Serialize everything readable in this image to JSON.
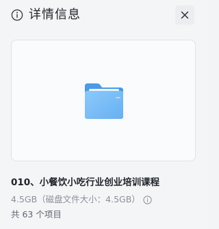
{
  "header": {
    "title": "详情信息",
    "icon": "info-icon",
    "close_icon": "close-icon"
  },
  "preview": {
    "icon": "folder-icon",
    "folder_color": "#6fb6f5"
  },
  "details": {
    "name": "010、小餐饮小吃行业创业培训课程",
    "size": "4.5GB",
    "disk_size": "（磁盘文件大小：4.5GB）",
    "help_icon": "help-circle-icon",
    "count": "共 63 个项目"
  }
}
